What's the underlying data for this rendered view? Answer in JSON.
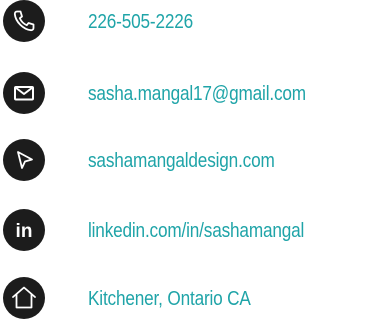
{
  "contacts": [
    {
      "icon": "phone-icon",
      "text": "226-505-2226"
    },
    {
      "icon": "envelope-icon",
      "text": "sasha.mangal17@gmail.com"
    },
    {
      "icon": "cursor-arrow-icon",
      "text": "sashamangaldesign.com"
    },
    {
      "icon": "linkedin-icon",
      "icon_text": "in",
      "text": "linkedin.com/in/sashamangal"
    },
    {
      "icon": "home-icon",
      "text": "Kitchener, Ontario CA"
    }
  ],
  "colors": {
    "icon_background": "#1c1c1c",
    "icon_foreground": "#ffffff",
    "text": "#1fa4a8"
  }
}
